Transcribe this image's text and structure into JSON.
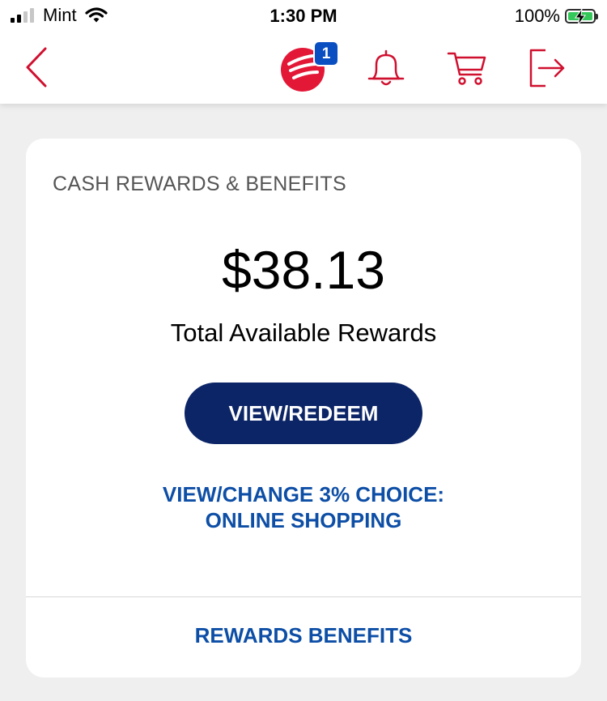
{
  "status_bar": {
    "carrier": "Mint",
    "time": "1:30 PM",
    "battery": "100%"
  },
  "nav": {
    "notification_count": "1",
    "icons": [
      "back-icon",
      "bofa-logo-icon",
      "bell-icon",
      "cart-icon",
      "logout-icon"
    ],
    "accent_color": "#d0102f"
  },
  "card": {
    "title": "CASH REWARDS & BENEFITS",
    "amount": "$38.13",
    "amount_label": "Total Available Rewards",
    "redeem_button": "VIEW/REDEEM",
    "choice_link_line1": "VIEW/CHANGE 3% CHOICE:",
    "choice_link_line2": "ONLINE SHOPPING",
    "benefits_link": "REWARDS BENEFITS"
  },
  "colors": {
    "button_bg": "#0c2567",
    "link_color": "#0d4ea6",
    "badge_bg": "#0a4fc2"
  }
}
